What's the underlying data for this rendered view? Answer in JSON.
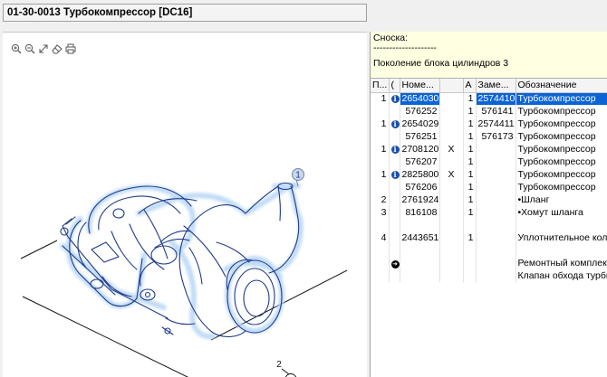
{
  "title": "01-30-0013 Турбокомпрессор [DC16]",
  "toolbar": {
    "icons": [
      "zoom-in-icon",
      "zoom-out-icon",
      "fit-icon",
      "eraser-icon",
      "print-icon"
    ]
  },
  "drawing": {
    "callouts": [
      {
        "label": "1"
      },
      {
        "label": "2"
      }
    ]
  },
  "note": {
    "heading": "Сноска:",
    "divider": "--------------------",
    "text": "Поколение блока цилиндров 3"
  },
  "table": {
    "headers": [
      "П...",
      "(",
      "Номе...",
      "",
      "А",
      "Заме...",
      "Обозначение"
    ],
    "rows": [
      {
        "pos": "1",
        "marker": "info",
        "number": "2654030",
        "x": "",
        "qty": "1",
        "replaced": "2574410",
        "desc": "Турбокомпрессор",
        "selected": true
      },
      {
        "pos": "",
        "marker": "",
        "number": "576252",
        "x": "",
        "qty": "1",
        "replaced": "576141",
        "desc": "Турбокомпрессор",
        "selected": false
      },
      {
        "pos": "1",
        "marker": "info",
        "number": "2654029",
        "x": "",
        "qty": "1",
        "replaced": "2574411",
        "desc": "Турбокомпрессор",
        "selected": false
      },
      {
        "pos": "",
        "marker": "",
        "number": "576251",
        "x": "",
        "qty": "1",
        "replaced": "576173",
        "desc": "Турбокомпрессор",
        "selected": false
      },
      {
        "pos": "1",
        "marker": "info",
        "number": "2708120",
        "x": "X",
        "qty": "1",
        "replaced": "",
        "desc": "Турбокомпрессор",
        "selected": false
      },
      {
        "pos": "",
        "marker": "",
        "number": "576207",
        "x": "",
        "qty": "1",
        "replaced": "",
        "desc": "Турбокомпрессор",
        "selected": false
      },
      {
        "pos": "1",
        "marker": "info",
        "number": "2825800",
        "x": "X",
        "qty": "1",
        "replaced": "",
        "desc": "Турбокомпрессор",
        "selected": false
      },
      {
        "pos": "",
        "marker": "",
        "number": "576206",
        "x": "",
        "qty": "1",
        "replaced": "",
        "desc": "Турбокомпрессор",
        "selected": false
      },
      {
        "pos": "2",
        "marker": "",
        "number": "2761924",
        "x": "",
        "qty": "1",
        "replaced": "",
        "desc": "•Шланг",
        "selected": false
      },
      {
        "pos": "3",
        "marker": "",
        "number": "816108",
        "x": "",
        "qty": "1",
        "replaced": "",
        "desc": "•Хомут шланга",
        "selected": false
      },
      {
        "pos": "",
        "marker": "",
        "number": "",
        "x": "",
        "qty": "",
        "replaced": "",
        "desc": "",
        "selected": false
      },
      {
        "pos": "4",
        "marker": "",
        "number": "2443651",
        "x": "",
        "qty": "1",
        "replaced": "",
        "desc": "Уплотнительное коль",
        "selected": false
      },
      {
        "pos": "",
        "marker": "",
        "number": "",
        "x": "",
        "qty": "",
        "replaced": "",
        "desc": "",
        "selected": false
      },
      {
        "pos": "",
        "marker": "arrow",
        "number": "",
        "x": "",
        "qty": "",
        "replaced": "",
        "desc": "Ремонтный комплект",
        "selected": false
      },
      {
        "pos": "",
        "marker": "",
        "number": "",
        "x": "",
        "qty": "",
        "replaced": "",
        "desc": "Клапан обхода турби",
        "selected": false
      }
    ]
  },
  "colors": {
    "selection": "#0a64d6",
    "drawing_stroke": "#1e3a8a",
    "drawing_glow": "#b9d7f7",
    "note_background": "#ffffe1",
    "callout_fill": "#c9d8ee"
  }
}
